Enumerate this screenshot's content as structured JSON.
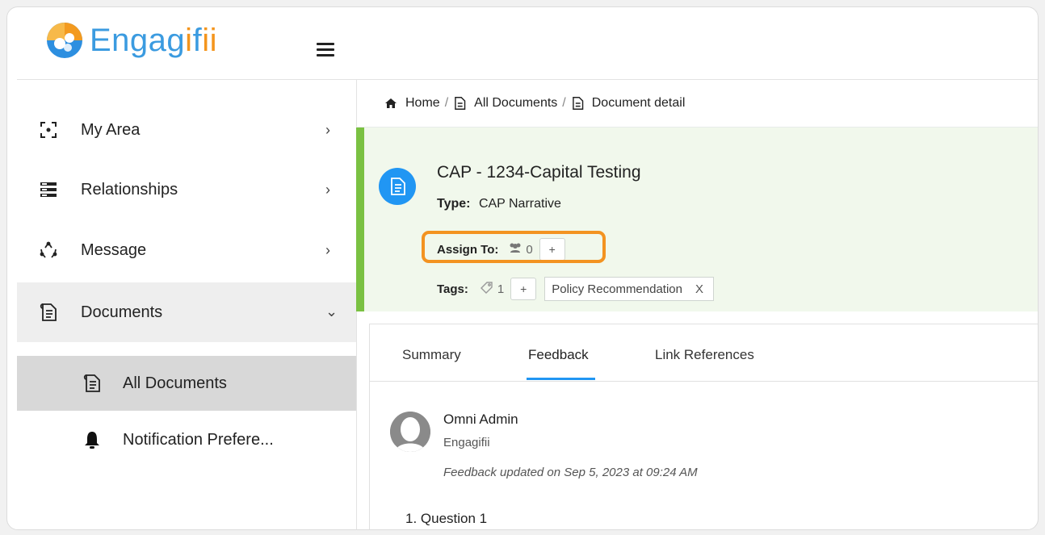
{
  "app": {
    "logo_text_primary": "Engag",
    "logo_text_accent": "i",
    "logo_text_end": "f",
    "logo_text_accent2": "ii",
    "menu_icon": "hamburger-icon"
  },
  "sidebar": {
    "items": [
      {
        "label": "My Area",
        "icon": "focus-icon",
        "chevron": "›"
      },
      {
        "label": "Relationships",
        "icon": "server-list-icon",
        "chevron": "›"
      },
      {
        "label": "Message",
        "icon": "recycle-icon",
        "chevron": "›"
      },
      {
        "label": "Documents",
        "icon": "document-icon",
        "chevron": "⌄"
      }
    ],
    "sub_items": [
      {
        "label": "All Documents",
        "icon": "document-icon"
      },
      {
        "label": "Notification Prefere...",
        "icon": "bell-icon"
      }
    ]
  },
  "breadcrumb": {
    "home": "Home",
    "all_documents": "All Documents",
    "current": "Document detail",
    "separator": "/"
  },
  "document": {
    "title": "CAP - 1234-Capital Testing",
    "type_label": "Type:",
    "type_value": "CAP Narrative",
    "assign_label": "Assign To:",
    "assign_count": "0",
    "assign_add": "+",
    "tags_label": "Tags:",
    "tags_count": "1",
    "tags_add": "+",
    "tags": [
      {
        "label": "Policy Recommendation",
        "remove": "X"
      }
    ]
  },
  "tabs": [
    {
      "label": "Summary"
    },
    {
      "label": "Feedback"
    },
    {
      "label": "Link References"
    }
  ],
  "feedback": {
    "author": "Omni Admin",
    "organization": "Engagifii",
    "updated": "Feedback updated on Sep 5, 2023 at 09:24 AM",
    "first_question": "1. Question 1"
  },
  "colors": {
    "brand_blue": "#3b9be0",
    "brand_orange": "#f4951d",
    "accent_green": "#7ac142",
    "tab_active": "#2196f3",
    "highlight": "#f39321"
  }
}
